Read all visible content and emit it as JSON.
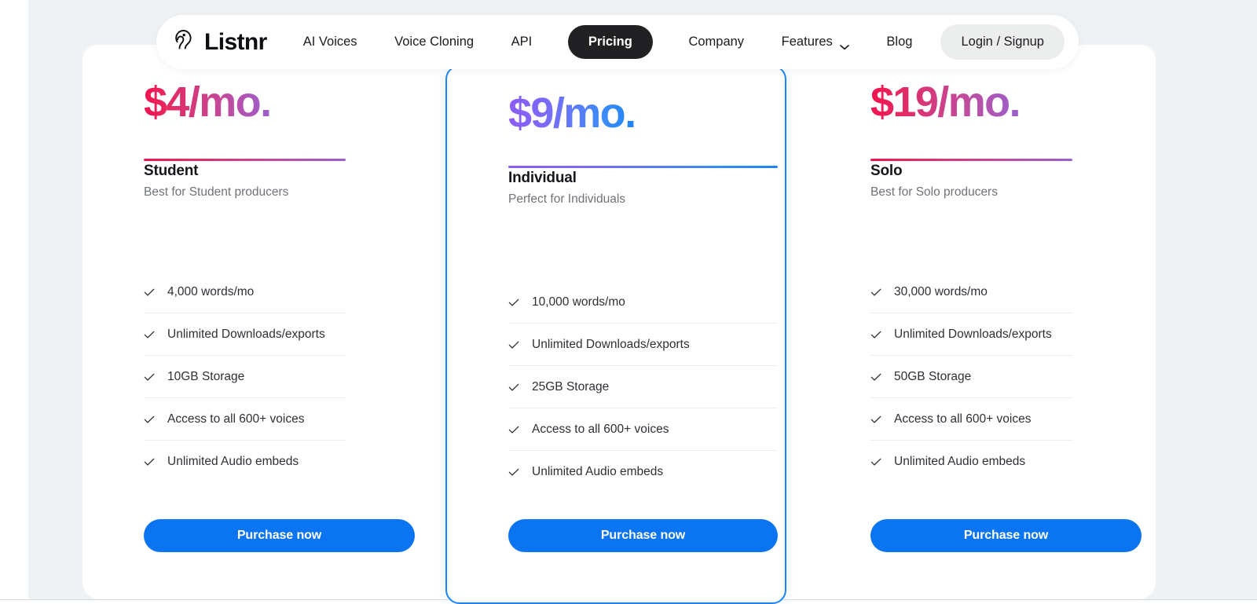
{
  "colors": {
    "page_background": "#eff2f5",
    "panel_background": "#ffffff",
    "nav_active_pill": "#212124",
    "login_pill": "#eceded",
    "purchase_button": "#0b74f0",
    "highlight_card_border": "#1f85f5",
    "gradient_pink_start": "#f2114f",
    "gradient_pink_end": "#9a60cf",
    "gradient_blue_start": "#8b5cf6",
    "gradient_blue_end": "#1f85f5",
    "muted_text": "#6f7378",
    "body_text": "#2e3036"
  },
  "nav": {
    "logo_text": "Listnr",
    "logo_icon": "ear-icon",
    "links": [
      {
        "label": "AI Voices",
        "active": false,
        "caret": false
      },
      {
        "label": "Voice Cloning",
        "active": false,
        "caret": false
      },
      {
        "label": "API",
        "active": false,
        "caret": false
      },
      {
        "label": "Pricing",
        "active": true,
        "caret": false
      },
      {
        "label": "Company",
        "active": false,
        "caret": false
      },
      {
        "label": "Features",
        "active": false,
        "caret": true
      },
      {
        "label": "Blog",
        "active": false,
        "caret": false
      }
    ],
    "login_label": "Login / Signup"
  },
  "pricing": {
    "cards": [
      {
        "price": "$4/mo.",
        "plan_name": "Student",
        "plan_sub": "Best for Student producers",
        "gradient": "pink",
        "highlighted": false,
        "features": [
          "4,000 words/mo",
          "Unlimited Downloads/exports",
          "10GB Storage",
          "Access to all 600+ voices",
          "Unlimited Audio embeds"
        ],
        "cta": "Purchase now"
      },
      {
        "price": "$9/mo.",
        "plan_name": "Individual",
        "plan_sub": "Perfect for Individuals",
        "gradient": "blue",
        "highlighted": true,
        "features": [
          "10,000 words/mo",
          "Unlimited Downloads/exports",
          "25GB Storage",
          "Access to all 600+ voices",
          "Unlimited Audio embeds"
        ],
        "cta": "Purchase now"
      },
      {
        "price": "$19/mo.",
        "plan_name": "Solo",
        "plan_sub": "Best for Solo producers",
        "gradient": "pink",
        "highlighted": false,
        "features": [
          "30,000 words/mo",
          "Unlimited Downloads/exports",
          "50GB Storage",
          "Access to all 600+ voices",
          "Unlimited Audio embeds"
        ],
        "cta": "Purchase now"
      }
    ]
  }
}
